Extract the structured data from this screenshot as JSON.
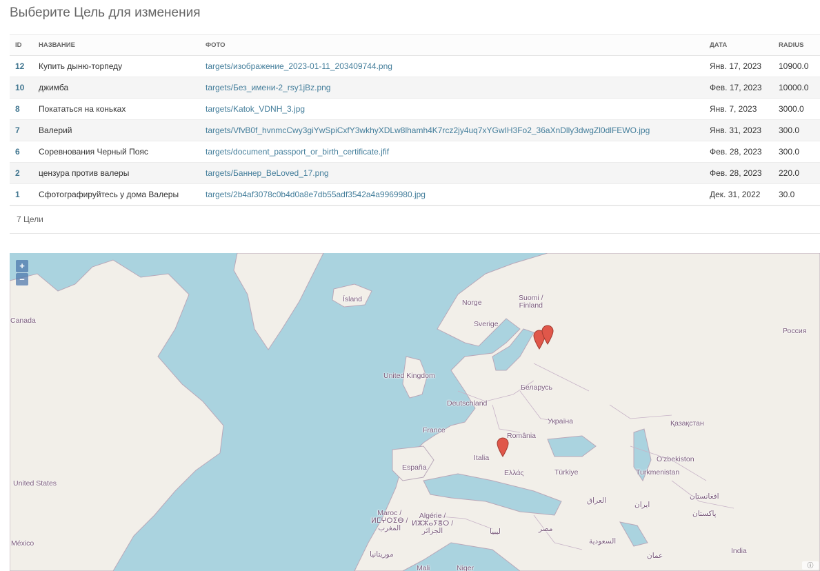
{
  "page": {
    "title": "Выберите Цель для изменения"
  },
  "table": {
    "headers": {
      "id": "ID",
      "name": "НАЗВАНИЕ",
      "photo": "ФОТО",
      "date": "ДАТА",
      "radius": "RADIUS"
    },
    "rows": [
      {
        "id": "12",
        "name": "Купить дыню-торпеду",
        "photo": "targets/изображение_2023-01-11_203409744.png",
        "date": "Янв. 17, 2023",
        "radius": "10900.0"
      },
      {
        "id": "10",
        "name": "джимба",
        "photo": "targets/Без_имени-2_rsy1jBz.png",
        "date": "Фев. 17, 2023",
        "radius": "10000.0"
      },
      {
        "id": "8",
        "name": "Покататься на коньках",
        "photo": "targets/Katok_VDNH_3.jpg",
        "date": "Янв. 7, 2023",
        "radius": "3000.0"
      },
      {
        "id": "7",
        "name": "Валерий",
        "photo": "targets/VfvB0f_hvnmcCwy3giYwSpiCxfY3wkhyXDLw8lhamh4K7rcz2jy4uq7xYGwIH3Fo2_36aXnDlly3dwgZl0dlFEWO.jpg",
        "date": "Янв. 31, 2023",
        "radius": "300.0"
      },
      {
        "id": "6",
        "name": "Соревнования Черный Пояс",
        "photo": "targets/document_passport_or_birth_certificate.jfif",
        "date": "Фев. 28, 2023",
        "radius": "300.0"
      },
      {
        "id": "2",
        "name": "цензура против валеры",
        "photo": "targets/Баннер_BeLoved_17.png",
        "date": "Фев. 28, 2023",
        "radius": "220.0"
      },
      {
        "id": "1",
        "name": "Сфотографируйтесь у дома Валеры",
        "photo": "targets/2b4af3078c0b4d0a8e7db55adf3542a4a9969980.jpg",
        "date": "Дек. 31, 2022",
        "radius": "30.0"
      }
    ]
  },
  "paginator": {
    "text": "7 Цели"
  },
  "map": {
    "zoom_in": "+",
    "zoom_out": "–",
    "attribution": "ⓘ",
    "colors": {
      "water": "#aad3df",
      "land": "#f2efe9",
      "border": "#b9a8b9",
      "marker": "#e0574a"
    },
    "labels": {
      "island": "Ísland",
      "norge": "Norge",
      "suomi": "Suomi /\nFinland",
      "sverige": "Sverige",
      "canada": "Canada",
      "russia": "Россия",
      "uk": "United Kingdom",
      "belarus": "Беларусь",
      "deutschland": "Deutschland",
      "ukraina": "Україна",
      "france": "France",
      "romania": "România",
      "kazakhstan": "Қазақстан",
      "italia": "Italia",
      "espana": "España",
      "ellas": "Ελλάς",
      "turkiye": "Türkiye",
      "uzbekistan": "O'zbekiston",
      "turkmenistan": "Turkmenistan",
      "usa": "United States",
      "iraq": "العراق",
      "afghanistan": "افغانستان",
      "iran": "ایران",
      "pakistan": "پاکستان",
      "maroc": "Maroc /\nⵍⵎⵖⵔⵉⴱ /\nالمغرب",
      "algerie": "Algérie /\nⵍⵣⵣⴰⵢⴻⵔ /\nالجزائر",
      "libya": "ليبيا",
      "egypt": "مصر",
      "saudi": "السعودية",
      "oman": "عمان",
      "india": "India",
      "mexico": "México",
      "mauritania": "موريتانيا",
      "mali": "Mali",
      "niger": "Niger"
    }
  }
}
